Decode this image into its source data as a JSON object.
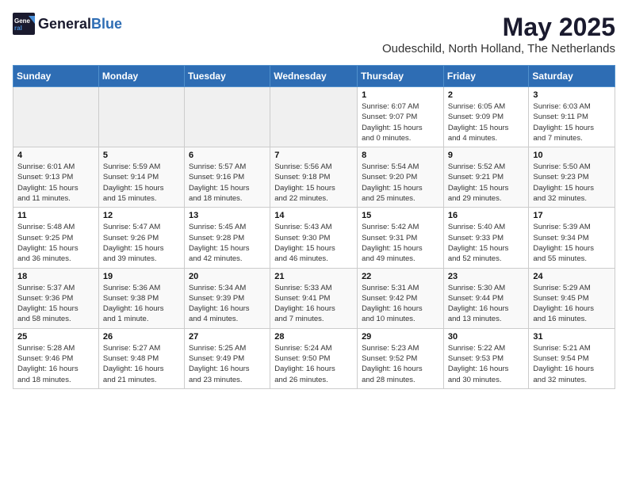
{
  "logo": {
    "text_general": "General",
    "text_blue": "Blue"
  },
  "title": "May 2025",
  "subtitle": "Oudeschild, North Holland, The Netherlands",
  "headers": [
    "Sunday",
    "Monday",
    "Tuesday",
    "Wednesday",
    "Thursday",
    "Friday",
    "Saturday"
  ],
  "weeks": [
    [
      {
        "day": "",
        "info": ""
      },
      {
        "day": "",
        "info": ""
      },
      {
        "day": "",
        "info": ""
      },
      {
        "day": "",
        "info": ""
      },
      {
        "day": "1",
        "info": "Sunrise: 6:07 AM\nSunset: 9:07 PM\nDaylight: 15 hours\nand 0 minutes."
      },
      {
        "day": "2",
        "info": "Sunrise: 6:05 AM\nSunset: 9:09 PM\nDaylight: 15 hours\nand 4 minutes."
      },
      {
        "day": "3",
        "info": "Sunrise: 6:03 AM\nSunset: 9:11 PM\nDaylight: 15 hours\nand 7 minutes."
      }
    ],
    [
      {
        "day": "4",
        "info": "Sunrise: 6:01 AM\nSunset: 9:13 PM\nDaylight: 15 hours\nand 11 minutes."
      },
      {
        "day": "5",
        "info": "Sunrise: 5:59 AM\nSunset: 9:14 PM\nDaylight: 15 hours\nand 15 minutes."
      },
      {
        "day": "6",
        "info": "Sunrise: 5:57 AM\nSunset: 9:16 PM\nDaylight: 15 hours\nand 18 minutes."
      },
      {
        "day": "7",
        "info": "Sunrise: 5:56 AM\nSunset: 9:18 PM\nDaylight: 15 hours\nand 22 minutes."
      },
      {
        "day": "8",
        "info": "Sunrise: 5:54 AM\nSunset: 9:20 PM\nDaylight: 15 hours\nand 25 minutes."
      },
      {
        "day": "9",
        "info": "Sunrise: 5:52 AM\nSunset: 9:21 PM\nDaylight: 15 hours\nand 29 minutes."
      },
      {
        "day": "10",
        "info": "Sunrise: 5:50 AM\nSunset: 9:23 PM\nDaylight: 15 hours\nand 32 minutes."
      }
    ],
    [
      {
        "day": "11",
        "info": "Sunrise: 5:48 AM\nSunset: 9:25 PM\nDaylight: 15 hours\nand 36 minutes."
      },
      {
        "day": "12",
        "info": "Sunrise: 5:47 AM\nSunset: 9:26 PM\nDaylight: 15 hours\nand 39 minutes."
      },
      {
        "day": "13",
        "info": "Sunrise: 5:45 AM\nSunset: 9:28 PM\nDaylight: 15 hours\nand 42 minutes."
      },
      {
        "day": "14",
        "info": "Sunrise: 5:43 AM\nSunset: 9:30 PM\nDaylight: 15 hours\nand 46 minutes."
      },
      {
        "day": "15",
        "info": "Sunrise: 5:42 AM\nSunset: 9:31 PM\nDaylight: 15 hours\nand 49 minutes."
      },
      {
        "day": "16",
        "info": "Sunrise: 5:40 AM\nSunset: 9:33 PM\nDaylight: 15 hours\nand 52 minutes."
      },
      {
        "day": "17",
        "info": "Sunrise: 5:39 AM\nSunset: 9:34 PM\nDaylight: 15 hours\nand 55 minutes."
      }
    ],
    [
      {
        "day": "18",
        "info": "Sunrise: 5:37 AM\nSunset: 9:36 PM\nDaylight: 15 hours\nand 58 minutes."
      },
      {
        "day": "19",
        "info": "Sunrise: 5:36 AM\nSunset: 9:38 PM\nDaylight: 16 hours\nand 1 minute."
      },
      {
        "day": "20",
        "info": "Sunrise: 5:34 AM\nSunset: 9:39 PM\nDaylight: 16 hours\nand 4 minutes."
      },
      {
        "day": "21",
        "info": "Sunrise: 5:33 AM\nSunset: 9:41 PM\nDaylight: 16 hours\nand 7 minutes."
      },
      {
        "day": "22",
        "info": "Sunrise: 5:31 AM\nSunset: 9:42 PM\nDaylight: 16 hours\nand 10 minutes."
      },
      {
        "day": "23",
        "info": "Sunrise: 5:30 AM\nSunset: 9:44 PM\nDaylight: 16 hours\nand 13 minutes."
      },
      {
        "day": "24",
        "info": "Sunrise: 5:29 AM\nSunset: 9:45 PM\nDaylight: 16 hours\nand 16 minutes."
      }
    ],
    [
      {
        "day": "25",
        "info": "Sunrise: 5:28 AM\nSunset: 9:46 PM\nDaylight: 16 hours\nand 18 minutes."
      },
      {
        "day": "26",
        "info": "Sunrise: 5:27 AM\nSunset: 9:48 PM\nDaylight: 16 hours\nand 21 minutes."
      },
      {
        "day": "27",
        "info": "Sunrise: 5:25 AM\nSunset: 9:49 PM\nDaylight: 16 hours\nand 23 minutes."
      },
      {
        "day": "28",
        "info": "Sunrise: 5:24 AM\nSunset: 9:50 PM\nDaylight: 16 hours\nand 26 minutes."
      },
      {
        "day": "29",
        "info": "Sunrise: 5:23 AM\nSunset: 9:52 PM\nDaylight: 16 hours\nand 28 minutes."
      },
      {
        "day": "30",
        "info": "Sunrise: 5:22 AM\nSunset: 9:53 PM\nDaylight: 16 hours\nand 30 minutes."
      },
      {
        "day": "31",
        "info": "Sunrise: 5:21 AM\nSunset: 9:54 PM\nDaylight: 16 hours\nand 32 minutes."
      }
    ]
  ]
}
